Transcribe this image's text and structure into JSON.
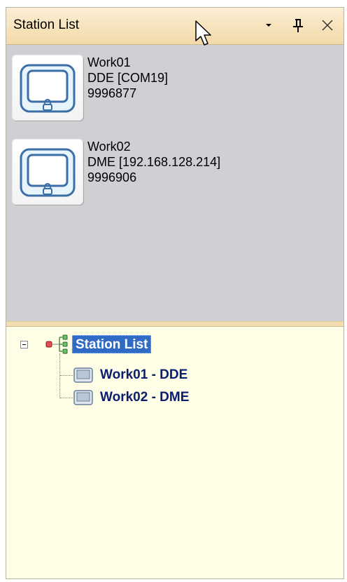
{
  "panel": {
    "title": "Station List"
  },
  "title_buttons": {
    "dropdown_icon": "dropdown-arrow-icon",
    "pin_icon": "pin-icon",
    "close_icon": "close-icon"
  },
  "stations": [
    {
      "name": "Work01",
      "connection": "DDE [COM19]",
      "serial": "9996877",
      "icon": "device-screen-icon"
    },
    {
      "name": "Work02",
      "connection": "DME [192.168.128.214]",
      "serial": "9996906",
      "icon": "device-screen-icon"
    }
  ],
  "tree": {
    "root_label": "Station List",
    "root_icon": "tree-root-icon",
    "children": [
      {
        "label": "Work01 - DDE",
        "icon": "device-icon"
      },
      {
        "label": "Work02 - DME",
        "icon": "device-icon"
      }
    ]
  },
  "colors": {
    "title_gradient": "#f7e4be",
    "station_bg": "#cfd0d4",
    "tree_bg": "#fefde6",
    "selection": "#316ac5",
    "tree_text": "#0a1e6e"
  }
}
